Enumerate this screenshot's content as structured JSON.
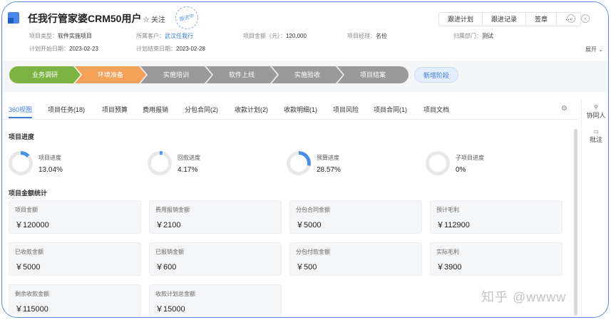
{
  "header": {
    "title": "任我行管家婆CRM50用户",
    "follow_label": "关注",
    "stamp_text": "跟进中",
    "actions": [
      "跟进计划",
      "跟进记录",
      "签章",
      "···"
    ],
    "meta": [
      {
        "label": "项目类型：",
        "value": "软件实施项目"
      },
      {
        "label": "所属客户：",
        "value": "武汉任我行"
      },
      {
        "label": "项目金额（元）：",
        "value": "120,000"
      },
      {
        "label": "项目经理：",
        "value": "名俭"
      },
      {
        "label": "归属部门：",
        "value": "测试"
      },
      {
        "label": "计划开始日期：",
        "value": "2023-02-23"
      },
      {
        "label": "计划结束日期：",
        "value": "2023-02-28"
      }
    ],
    "expand_label": "展开"
  },
  "stages": {
    "items": [
      {
        "label": "业务调研",
        "color": "#7cb342"
      },
      {
        "label": "环境准备",
        "color": "#f4a259"
      },
      {
        "label": "实施培训",
        "color": "#9e9e9e"
      },
      {
        "label": "软件上线",
        "color": "#9e9e9e"
      },
      {
        "label": "实施验收",
        "color": "#9e9e9e"
      },
      {
        "label": "项目结案",
        "color": "#9e9e9e"
      }
    ],
    "new_stage_label": "新增阶段"
  },
  "tabs": [
    "360视图",
    "项目任务(18)",
    "项目预算",
    "费用报销",
    "分包合同(2)",
    "收款计划(2)",
    "收款明细(1)",
    "项目风险",
    "项目合同(1)",
    "项目文档"
  ],
  "side": [
    {
      "icon": "collaborator-icon",
      "label": "协同人"
    },
    {
      "icon": "comment-icon",
      "label": "批注"
    }
  ],
  "progress_section": {
    "title": "项目进度",
    "items": [
      {
        "label": "项目进度",
        "value": "13.04%",
        "fraction": 0.1304
      },
      {
        "label": "回款进度",
        "value": "4.17%",
        "fraction": 0.0417
      },
      {
        "label": "预算进度",
        "value": "28.57%",
        "fraction": 0.2857
      },
      {
        "label": "子项目进度",
        "value": "0%",
        "fraction": 0
      }
    ]
  },
  "amount_section": {
    "title": "项目金额统计",
    "cards": [
      {
        "label": "项目金额",
        "value": "￥120000"
      },
      {
        "label": "费用报销金额",
        "value": "￥2100"
      },
      {
        "label": "分包合同金额",
        "value": "￥5000"
      },
      {
        "label": "预计毛利",
        "value": "￥112900"
      },
      {
        "label": "已收款金额",
        "value": "￥5000"
      },
      {
        "label": "已报销金额",
        "value": "￥600"
      },
      {
        "label": "分包付款金额",
        "value": "￥500"
      },
      {
        "label": "实际毛利",
        "value": "￥3900"
      },
      {
        "label": "剩余收款金额",
        "value": "￥115000"
      },
      {
        "label": "收款计划总金额",
        "value": "￥15000"
      }
    ]
  },
  "watermark": "知乎 @wwww",
  "colors": {
    "accent": "#3a7bd5",
    "ring_track": "#e8e8e8",
    "ring_fill": "#4a90e2"
  }
}
